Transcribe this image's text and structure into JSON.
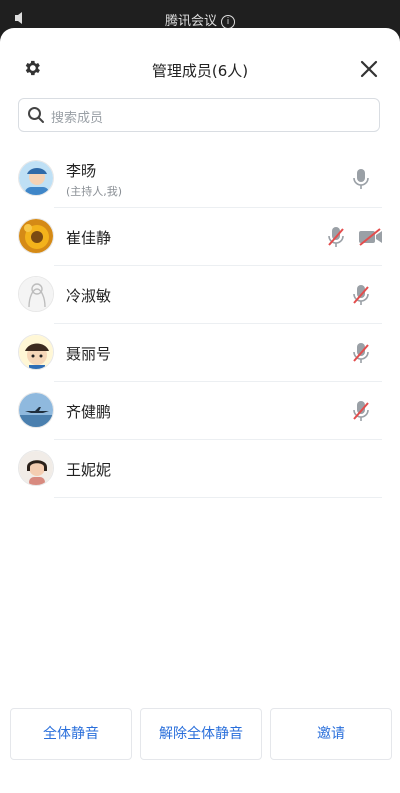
{
  "statusbar": {
    "title": "腾讯会议",
    "info_icon": "info-circle-icon",
    "leave_label": "",
    "left_icon": "speaker-icon"
  },
  "header": {
    "title": "管理成员(6人)",
    "settings_icon": "gear-icon",
    "close_icon": "close-icon"
  },
  "search": {
    "placeholder": "搜索成员",
    "icon": "search-icon"
  },
  "members": [
    {
      "name": "李旸",
      "subtitle": "(主持人,我)",
      "mic": "on",
      "camera": "none",
      "avatar": "avatar-lijun"
    },
    {
      "name": "崔佳静",
      "subtitle": "",
      "mic": "muted",
      "camera": "off",
      "avatar": "avatar-sunflower"
    },
    {
      "name": "冷淑敏",
      "subtitle": "",
      "mic": "muted",
      "camera": "none",
      "avatar": "avatar-sketch"
    },
    {
      "name": "聂丽号",
      "subtitle": "",
      "mic": "muted",
      "camera": "none",
      "avatar": "avatar-cartoon"
    },
    {
      "name": "齐健鹏",
      "subtitle": "",
      "mic": "muted",
      "camera": "none",
      "avatar": "avatar-plane"
    },
    {
      "name": "王妮妮",
      "subtitle": "",
      "mic": "none",
      "camera": "none",
      "avatar": "avatar-portrait"
    }
  ],
  "buttons": {
    "mute_all": "全体静音",
    "unmute_all": "解除全体静音",
    "invite": "邀请"
  },
  "colors": {
    "accent": "#2a6fdb",
    "muted_red": "#e34d4d",
    "icon_gray": "#9aa0a6",
    "sheet_bg": "#ffffff",
    "topbar_bg": "#1f1f1f"
  }
}
